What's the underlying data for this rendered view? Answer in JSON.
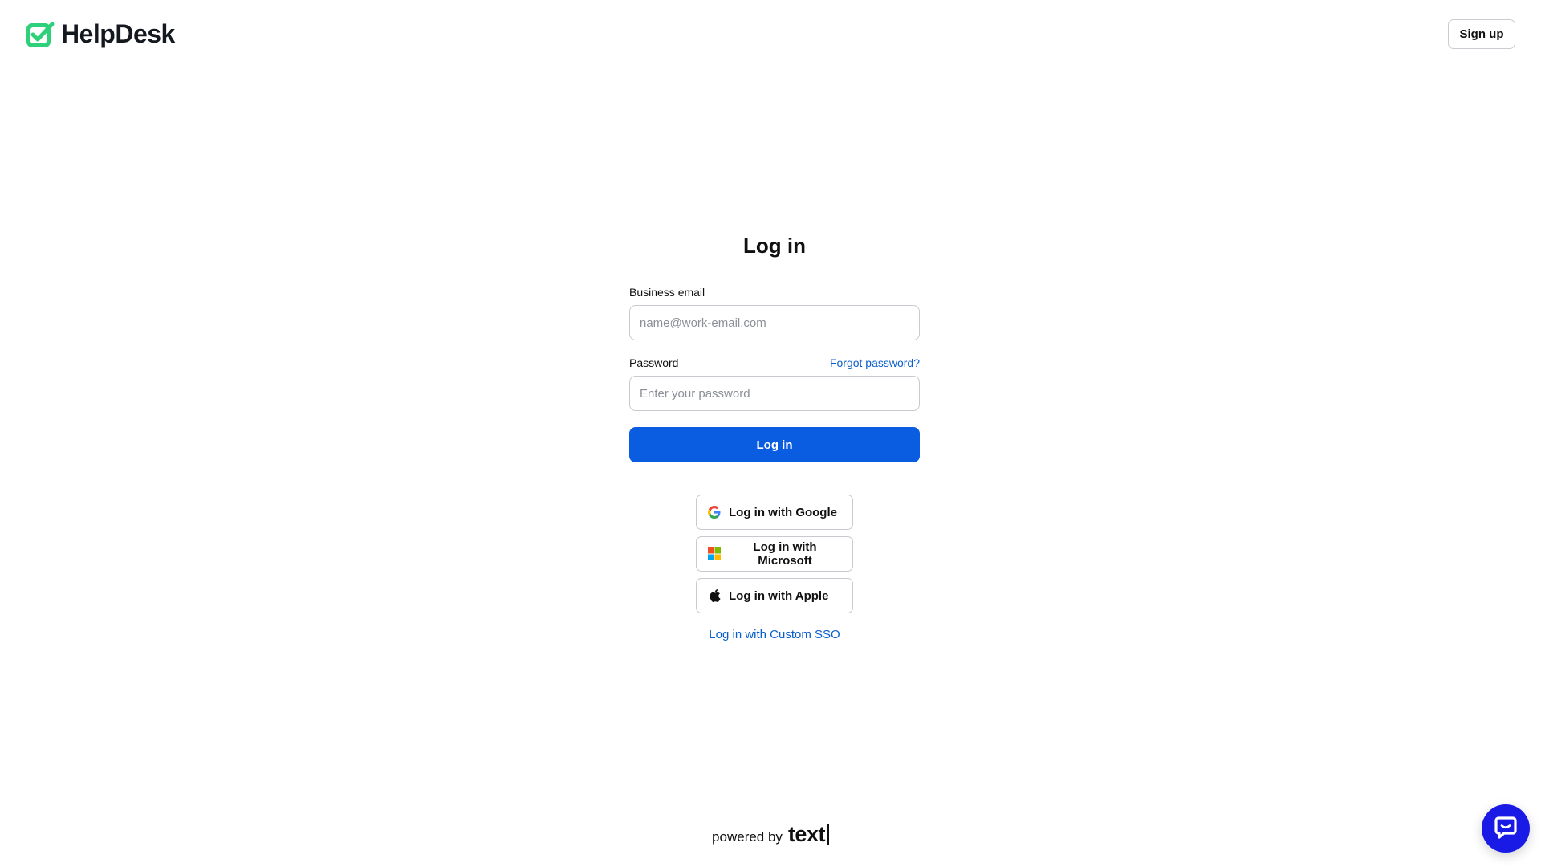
{
  "header": {
    "logo_text": "HelpDesk",
    "signup_label": "Sign up"
  },
  "login": {
    "title": "Log in",
    "email_label": "Business email",
    "email_placeholder": "name@work-email.com",
    "email_value": "",
    "password_label": "Password",
    "password_placeholder": "Enter your password",
    "password_value": "",
    "forgot_label": "Forgot password?",
    "submit_label": "Log in",
    "google_label": "Log in with Google",
    "microsoft_label": "Log in with Microsoft",
    "apple_label": "Log in with Apple",
    "custom_sso_label": "Log in with Custom SSO"
  },
  "footer": {
    "powered_by": "powered by",
    "brand": "text"
  },
  "icons": {
    "logo": "check-square-icon",
    "google": "google-icon",
    "microsoft": "microsoft-icon",
    "apple": "apple-icon",
    "chat": "chat-bubble-icon"
  },
  "colors": {
    "brand_green": "#2fd07a",
    "primary_blue": "#0a5ce0",
    "link_blue": "#0b5fcc",
    "chat_blue": "#1a1ae6"
  }
}
